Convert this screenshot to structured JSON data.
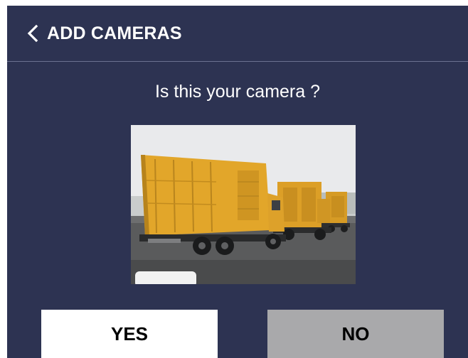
{
  "header": {
    "title": "ADD CAMERAS",
    "back_icon": "chevron-left-icon"
  },
  "prompt": {
    "question": "Is this your camera ?"
  },
  "preview": {
    "description_icon": "camera-snapshot-image"
  },
  "actions": {
    "yes_label": "YES",
    "no_label": "NO"
  },
  "colors": {
    "background": "#2d3352",
    "divider": "#6b7291",
    "yes_button": "#ffffff",
    "no_button": "#a9a9ab",
    "truck_body": "#e0a52a"
  }
}
